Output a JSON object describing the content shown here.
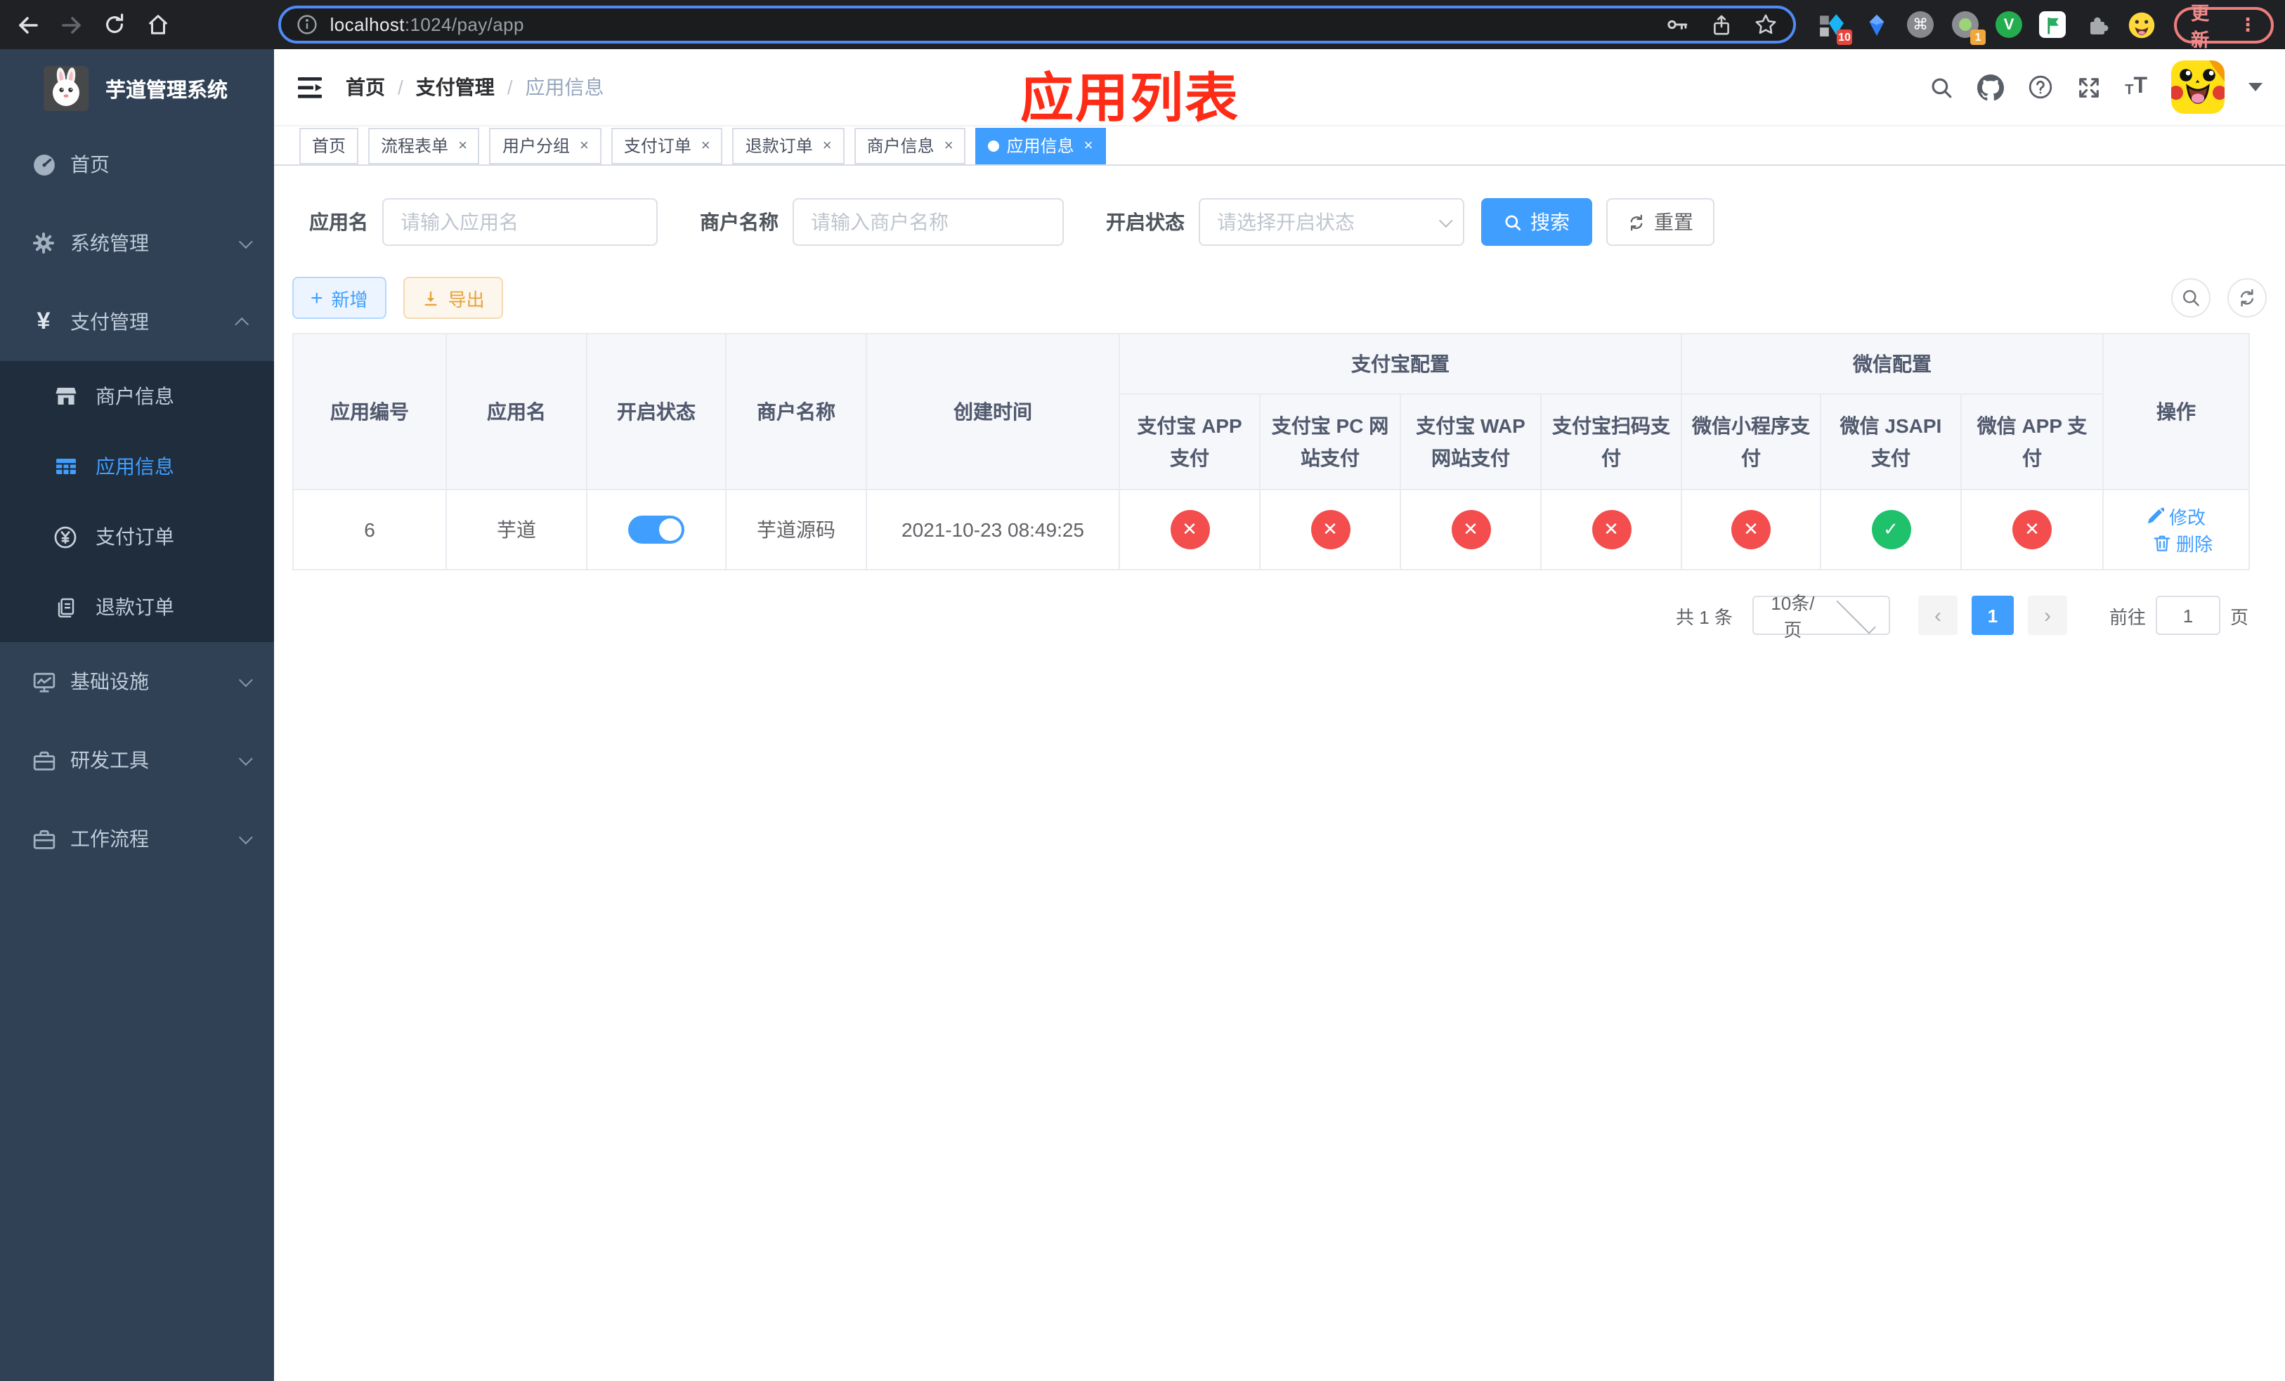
{
  "colors": {
    "primary": "#409eff",
    "success": "#1fc16b",
    "danger": "#f34d4d",
    "warning": "#e6a23c",
    "annotation": "#fe2c16",
    "sidebar_bg": "#304156",
    "submenu_bg": "#1f2d3d"
  },
  "browser": {
    "url_host": "localhost",
    "url_rest": ":1024/pay/app",
    "update_label": "更新",
    "ext_badge_a": "10",
    "ext_badge_b": "1"
  },
  "annotation": {
    "text": "应用列表"
  },
  "sidebar": {
    "title": "芋道管理系统",
    "items": [
      {
        "label": "首页"
      },
      {
        "label": "系统管理"
      },
      {
        "label": "支付管理"
      },
      {
        "label": "基础设施"
      },
      {
        "label": "研发工具"
      },
      {
        "label": "工作流程"
      }
    ],
    "submenu": [
      {
        "label": "商户信息"
      },
      {
        "label": "应用信息"
      },
      {
        "label": "支付订单"
      },
      {
        "label": "退款订单"
      }
    ]
  },
  "breadcrumb": {
    "items": [
      "首页",
      "支付管理",
      "应用信息"
    ],
    "separator": "/"
  },
  "tabs": [
    {
      "label": "首页"
    },
    {
      "label": "流程表单",
      "close": "×"
    },
    {
      "label": "用户分组",
      "close": "×"
    },
    {
      "label": "支付订单",
      "close": "×"
    },
    {
      "label": "退款订单",
      "close": "×"
    },
    {
      "label": "商户信息",
      "close": "×"
    },
    {
      "label": "应用信息",
      "close": "×"
    }
  ],
  "filter": {
    "app_name": {
      "label": "应用名",
      "placeholder": "请输入应用名"
    },
    "merchant_name": {
      "label": "商户名称",
      "placeholder": "请输入商户名称"
    },
    "status": {
      "label": "开启状态",
      "placeholder": "请选择开启状态"
    },
    "search": "搜索",
    "reset": "重置"
  },
  "toolbar": {
    "add": "新增",
    "export": "导出"
  },
  "table": {
    "cols": [
      "应用编号",
      "应用名",
      "开启状态",
      "商户名称",
      "创建时间"
    ],
    "group_alipay": "支付宝配置",
    "group_wechat": "微信配置",
    "alipay_cols": [
      "支付宝 APP 支付",
      "支付宝 PC 网站支付",
      "支付宝 WAP 网站支付",
      "支付宝扫码支付"
    ],
    "wechat_cols": [
      "微信小程序支付",
      "微信 JSAPI 支付",
      "微信 APP 支付"
    ],
    "op_col": "操作",
    "row": {
      "id": "6",
      "name": "芋道",
      "switch_cls": "el-switch is-on",
      "merchant": "芋道源码",
      "created": "2021-10-23 08:49:25",
      "statuses": [
        {
          "glyph": "✕",
          "cls": "status-circle no"
        },
        {
          "glyph": "✕",
          "cls": "status-circle no"
        },
        {
          "glyph": "✕",
          "cls": "status-circle no"
        },
        {
          "glyph": "✕",
          "cls": "status-circle no"
        },
        {
          "glyph": "✕",
          "cls": "status-circle no"
        },
        {
          "glyph": "✓",
          "cls": "status-circle yes"
        },
        {
          "glyph": "✕",
          "cls": "status-circle no"
        }
      ],
      "edit": "修改",
      "delete": "删除"
    }
  },
  "pagination": {
    "total": "共 1 条",
    "size": "10条/页",
    "page": "1",
    "goto": "前往",
    "goto_value": "1",
    "unit": "页"
  }
}
